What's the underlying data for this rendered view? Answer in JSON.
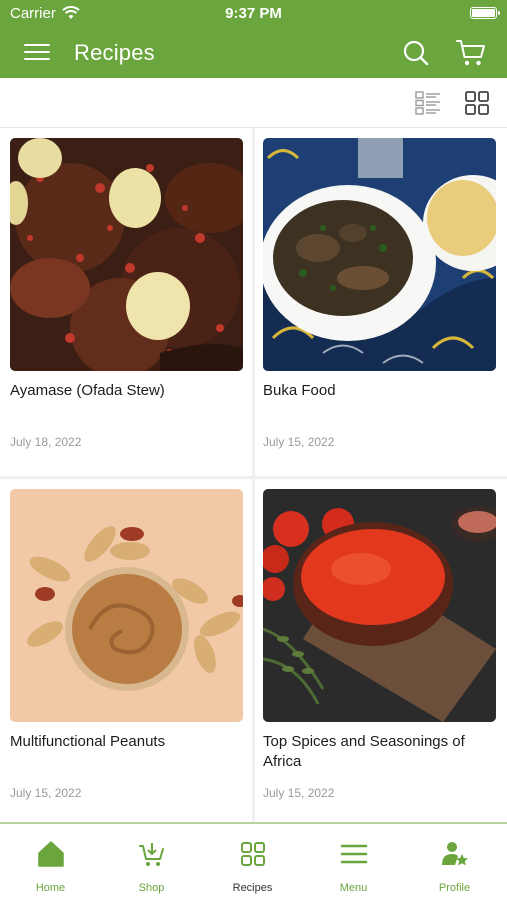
{
  "status_bar": {
    "carrier": "Carrier",
    "time": "9:37 PM"
  },
  "app_bar": {
    "title": "Recipes",
    "icons": [
      "menu-icon",
      "search-icon",
      "cart-icon"
    ]
  },
  "view_toolbar": {
    "icons": [
      "list-view-icon",
      "grid-view-icon"
    ],
    "active": "grid-view"
  },
  "recipes": [
    {
      "title": "Ayamase (Ofada Stew)",
      "date": "July 18, 2022"
    },
    {
      "title": "Buka Food",
      "date": "July 15, 2022"
    },
    {
      "title": "Multifunctional Peanuts",
      "date": "July 15, 2022"
    },
    {
      "title": "Top Spices and Seasonings of Africa",
      "date": "July 15, 2022"
    }
  ],
  "bottom_nav": [
    {
      "label": "Home",
      "icon": "home-icon"
    },
    {
      "label": "Shop",
      "icon": "shop-cart-icon"
    },
    {
      "label": "Recipes",
      "icon": "recipes-grid-icon"
    },
    {
      "label": "Menu",
      "icon": "menu-lines-icon"
    },
    {
      "label": "Profile",
      "icon": "profile-star-icon"
    }
  ],
  "colors": {
    "brand_green": "#6aa53d",
    "active_label": "#333333",
    "date_gray": "#9a9a9a"
  }
}
